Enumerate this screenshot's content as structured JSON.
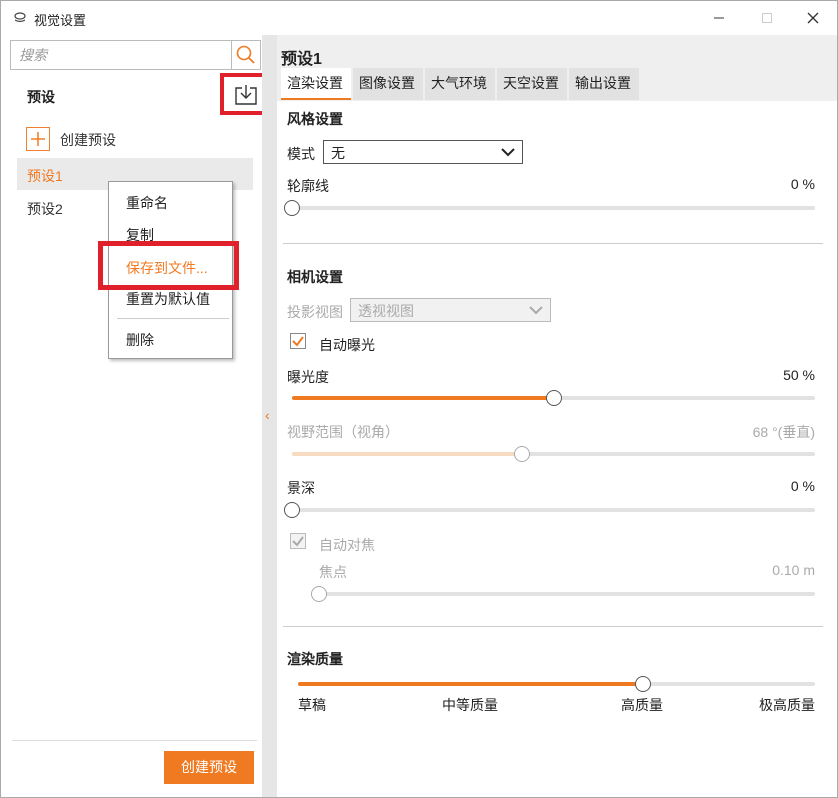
{
  "window": {
    "title": "视觉设置",
    "minimize_icon": "minimize-icon",
    "maximize_icon": "maximize-icon",
    "close_icon": "close-icon"
  },
  "left_panel": {
    "search": {
      "placeholder": "搜索",
      "value": ""
    },
    "section_title": "预设",
    "create_link": "创建预设",
    "presets": [
      {
        "label": "预设1",
        "selected": true
      },
      {
        "label": "预设2",
        "selected": false
      }
    ],
    "create_button": "创建预设"
  },
  "context_menu": {
    "items": [
      {
        "label": "重命名"
      },
      {
        "label": "复制"
      },
      {
        "label": "保存到文件..."
      },
      {
        "label": "重置为默认值"
      },
      {
        "label": "删除"
      }
    ]
  },
  "right_panel": {
    "preset_title": "预设1",
    "tabs": [
      {
        "label": "渲染设置",
        "active": true
      },
      {
        "label": "图像设置",
        "active": false
      },
      {
        "label": "大气环境",
        "active": false
      },
      {
        "label": "天空设置",
        "active": false
      },
      {
        "label": "输出设置",
        "active": false
      }
    ],
    "style": {
      "title": "风格设置",
      "mode_label": "模式",
      "mode_value": "无",
      "outline_label": "轮廓线",
      "outline_value_text": "0 %",
      "outline_value": 0
    },
    "camera": {
      "title": "相机设置",
      "projection_label": "投影视图",
      "projection_value": "透视视图",
      "auto_exposure_label": "自动曝光",
      "auto_exposure_checked": true,
      "exposure_label": "曝光度",
      "exposure_value_text": "50 %",
      "exposure_value": 50,
      "fov_label": "视野范围（视角）",
      "fov_value_text": "68 °(垂直)",
      "fov_fraction": 0.44,
      "dof_label": "景深",
      "dof_value_text": "0 %",
      "dof_value": 0,
      "autofocus_label": "自动对焦",
      "autofocus_checked": true,
      "focus_label": "焦点",
      "focus_value_text": "0.10 m",
      "focus_fraction": 0
    },
    "quality": {
      "title": "渲染质量",
      "levels": [
        "草稿",
        "中等质量",
        "高质量",
        "极高质量"
      ],
      "selected_index": 2,
      "fraction": 0.667
    }
  },
  "colors": {
    "accent": "#f07a22",
    "highlight_box": "#e0202a"
  }
}
